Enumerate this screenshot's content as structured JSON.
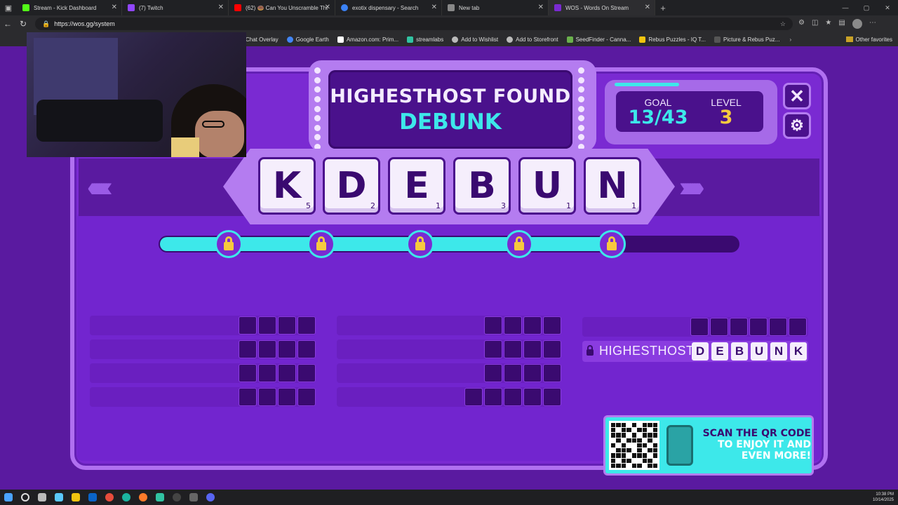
{
  "browser": {
    "tabs": [
      {
        "title": "Stream - Kick Dashboard",
        "color": "#53fc18",
        "active": false
      },
      {
        "title": "(7) Twitch",
        "color": "#9146ff",
        "active": false
      },
      {
        "title": "(62) 🍩 Can You Unscramble Thi",
        "color": "#ff0000",
        "active": false
      },
      {
        "title": "exotix dispensary - Search",
        "color": "#3b82f6",
        "active": false
      },
      {
        "title": "New tab",
        "color": "#888888",
        "active": false
      },
      {
        "title": "WOS - Words On Stream",
        "color": "#7a2ad2",
        "active": true
      }
    ],
    "url": "https://wos.gg/system",
    "bookmarks": [
      {
        "label": "Chat Overlay",
        "color": "#9a9a9a"
      },
      {
        "label": "Google Earth",
        "color": "#4285f4"
      },
      {
        "label": "Amazon.com: Prim...",
        "color": "#ffffff"
      },
      {
        "label": "streamlabs",
        "color": "#31c3a2"
      },
      {
        "label": "Add to Wishlist",
        "color": "#bbbbbb"
      },
      {
        "label": "Add to Storefront",
        "color": "#bbbbbb"
      },
      {
        "label": "SeedFinder - Canna...",
        "color": "#6ab04c"
      },
      {
        "label": "Rebus Puzzles - IQ T...",
        "color": "#f1c40f"
      },
      {
        "label": "Picture & Rebus Puz...",
        "color": "#555555"
      }
    ],
    "other_favorites": "Other favorites"
  },
  "game": {
    "title_line1": "HIGHESTHOST FOUND",
    "title_line2": "DEBUNK",
    "goal_label": "GOAL",
    "goal_value": "13/43",
    "level_label": "LEVEL",
    "level_value": "3",
    "close_icon": "close-icon",
    "settings_icon": "gear-icon",
    "tiles": [
      {
        "letter": "K",
        "points": "5"
      },
      {
        "letter": "D",
        "points": "2"
      },
      {
        "letter": "E",
        "points": "1"
      },
      {
        "letter": "B",
        "points": "3"
      },
      {
        "letter": "U",
        "points": "1"
      },
      {
        "letter": "N",
        "points": "1"
      }
    ],
    "progress_fraction": 0.8,
    "found_word": {
      "player": "HIGHESTHOST",
      "letters": [
        "D",
        "E",
        "B",
        "U",
        "N",
        "K"
      ]
    },
    "qr_text_a": "SCAN THE QR CODE",
    "qr_text_b": "TO ENJOY IT AND EVEN MORE!"
  },
  "taskbar": {
    "time": "10:38 PM",
    "date": "10/14/2025"
  },
  "colors": {
    "accent_cyan": "#3de8ea",
    "accent_gold": "#f7c93e",
    "purple_bg": "#5a1aa0"
  }
}
